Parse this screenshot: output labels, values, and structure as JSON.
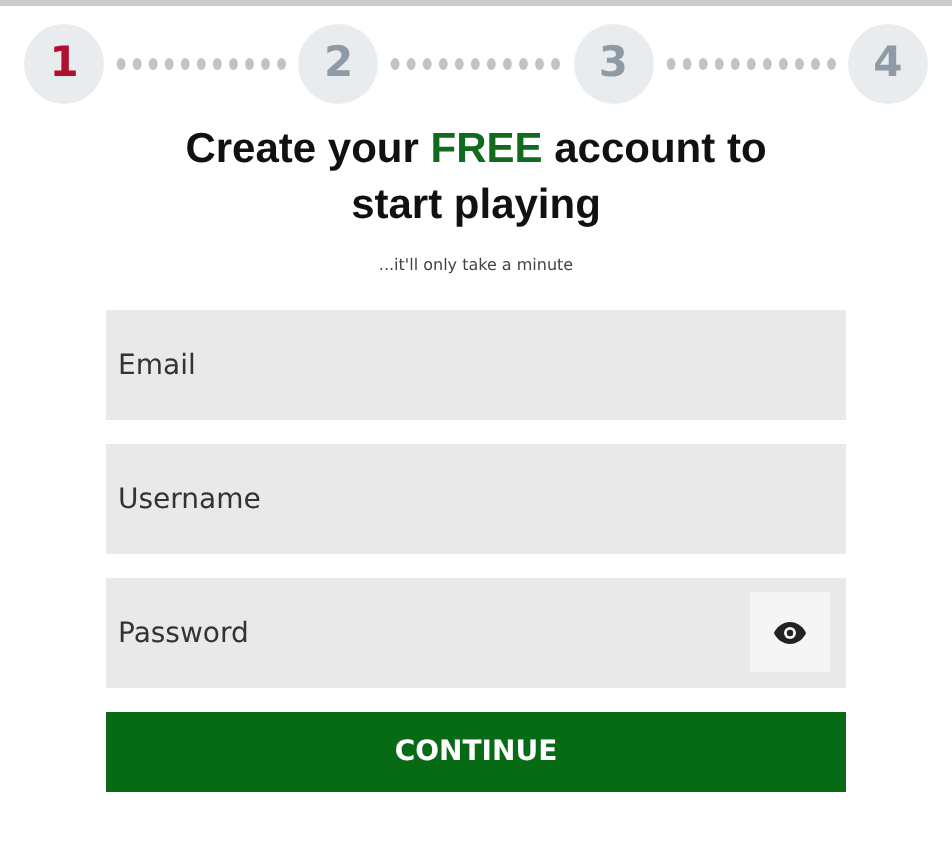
{
  "steps": [
    {
      "label": "1",
      "selected": true
    },
    {
      "label": "2",
      "selected": false
    },
    {
      "label": "3",
      "selected": false
    },
    {
      "label": "4",
      "selected": false
    }
  ],
  "title": [
    {
      "text": "Create your ",
      "highlight": false
    },
    {
      "text": "FREE",
      "highlight": true
    },
    {
      "text": " account to start playing",
      "highlight": false
    }
  ],
  "subtitle": "...it'll only take a minute",
  "fields": [
    {
      "placeholder": "Email",
      "kind": "text"
    },
    {
      "placeholder": "Username",
      "kind": "text"
    },
    {
      "placeholder": "Password",
      "kind": "password"
    }
  ],
  "button": "CONTINUE"
}
